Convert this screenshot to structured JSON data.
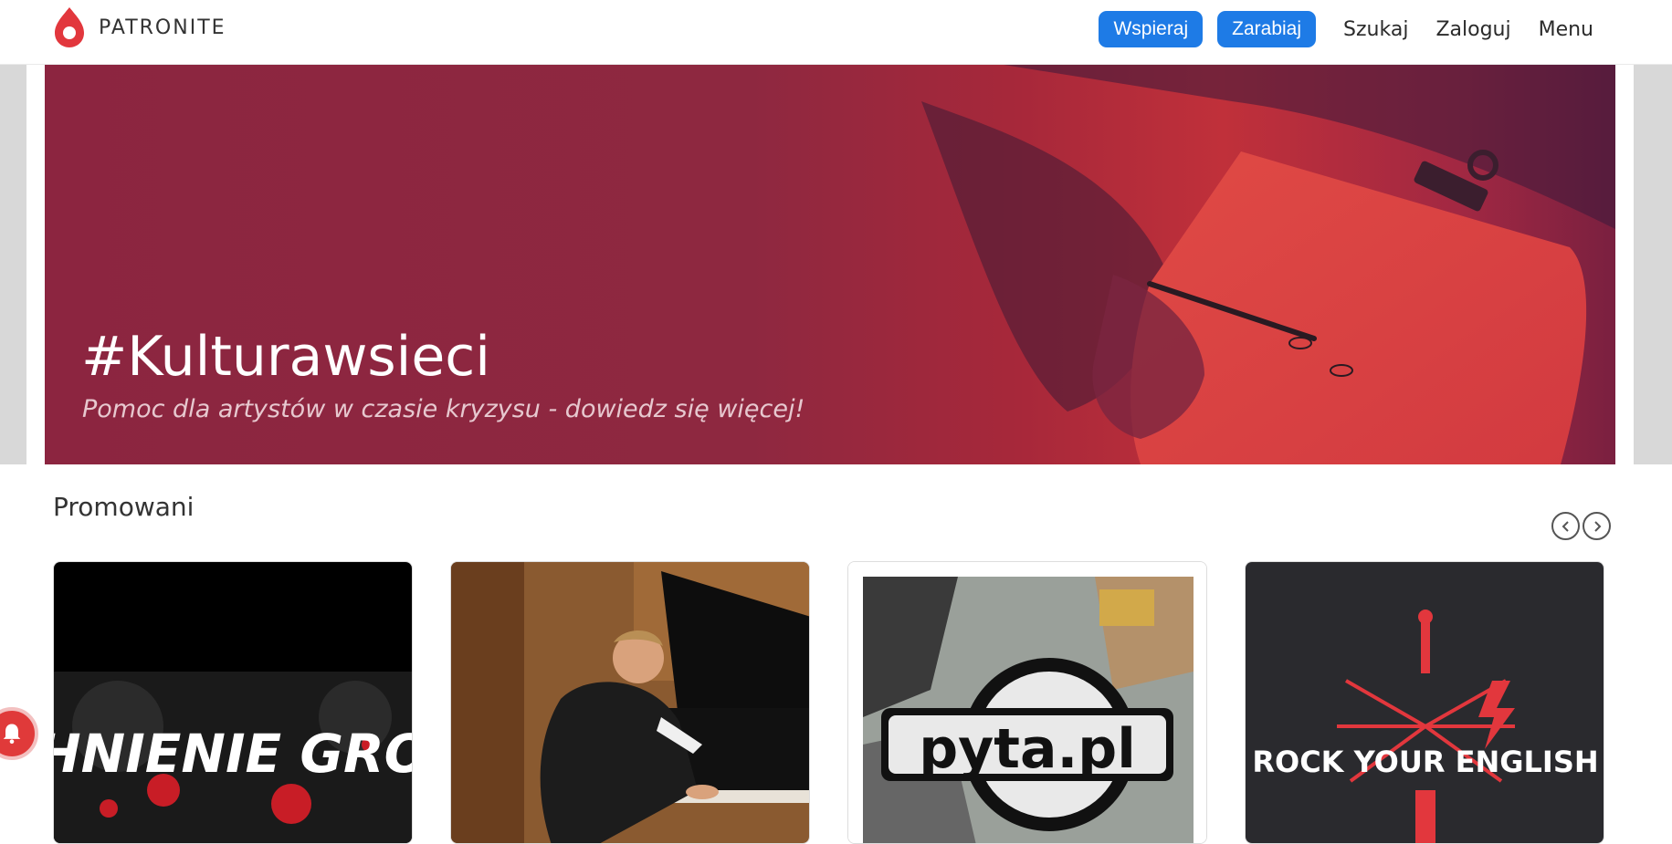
{
  "header": {
    "logo_text": "PATRONITE",
    "nav": {
      "support_label": "Wspieraj",
      "earn_label": "Zarabiaj",
      "search_label": "Szukaj",
      "login_label": "Zaloguj",
      "menu_label": "Menu"
    }
  },
  "hero": {
    "title": "#Kulturawsieci",
    "subtitle": "Pomoc dla artystów w czasie kryzysu - dowiedz się więcej!"
  },
  "promoted": {
    "title": "Promowani",
    "cards": [
      {
        "label": "TCHNIENIE GROZY",
        "bg": "#000000",
        "accent": "#d11f2a"
      },
      {
        "label": "",
        "bg": "#7a4a22",
        "accent": "#111111"
      },
      {
        "label": "pyta.pl",
        "bg": "#d8d8d8",
        "accent": "#111111"
      },
      {
        "label": "ROCK YOUR ENGLISH",
        "bg": "#2a2a2e",
        "accent": "#e2373d"
      }
    ]
  },
  "colors": {
    "brand_red": "#e2373d",
    "accent_blue": "#1e7be6"
  },
  "icons": [
    "patronite-logo-icon",
    "chevron-left-icon",
    "chevron-right-icon",
    "bell-icon"
  ]
}
